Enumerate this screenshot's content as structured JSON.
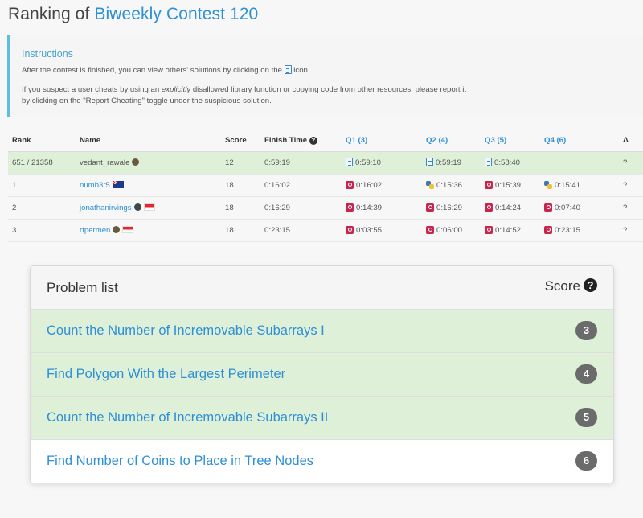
{
  "header": {
    "prefix": "Ranking of",
    "contest": "Biweekly Contest 120"
  },
  "instructions": {
    "title": "Instructions",
    "line1_before": "After the contest is finished, you can view others' solutions by clicking on the",
    "line1_after": "icon.",
    "line2_a": "If you suspect a user cheats by using an",
    "line2_em": "explicitly",
    "line2_b": "disallowed library function or copying code from other resources, please report it by clicking on the \"Report Cheating\" toggle under the suspicious solution."
  },
  "ranking": {
    "columns": {
      "rank": "Rank",
      "name": "Name",
      "score": "Score",
      "finish": "Finish Time",
      "q1": "Q1 (3)",
      "q2": "Q2 (4)",
      "q3": "Q3 (5)",
      "q4": "Q4 (6)",
      "delta": "Δ"
    },
    "rows": [
      {
        "rank": "651 / 21358",
        "name": "vedant_rawale",
        "score": "12",
        "finish": "0:59:19",
        "q1": "0:59:10",
        "q2": "0:59:19",
        "q3": "0:58:40",
        "q4": "",
        "delta": "?"
      },
      {
        "rank": "1",
        "name": "numb3r5",
        "score": "18",
        "finish": "0:16:02",
        "q1": "0:16:02",
        "q2": "0:15:36",
        "q3": "0:15:39",
        "q4": "0:15:41",
        "delta": "?"
      },
      {
        "rank": "2",
        "name": "jonathanirvings",
        "score": "18",
        "finish": "0:16:29",
        "q1": "0:14:39",
        "q2": "0:16:29",
        "q3": "0:14:24",
        "q4": "0:07:40",
        "delta": "?"
      },
      {
        "rank": "3",
        "name": "rfpermen",
        "score": "18",
        "finish": "0:23:15",
        "q1": "0:03:55",
        "q2": "0:06:00",
        "q3": "0:14:52",
        "q4": "0:23:15",
        "delta": "?"
      }
    ]
  },
  "problems": {
    "title": "Problem list",
    "score_label": "Score",
    "items": [
      {
        "name": "Count the Number of Incremovable Subarrays I",
        "score": "3"
      },
      {
        "name": "Find Polygon With the Largest Perimeter",
        "score": "4"
      },
      {
        "name": "Count the Number of Incremovable Subarrays II",
        "score": "5"
      },
      {
        "name": "Find Number of Coins to Place in Tree Nodes",
        "score": "6"
      }
    ]
  }
}
